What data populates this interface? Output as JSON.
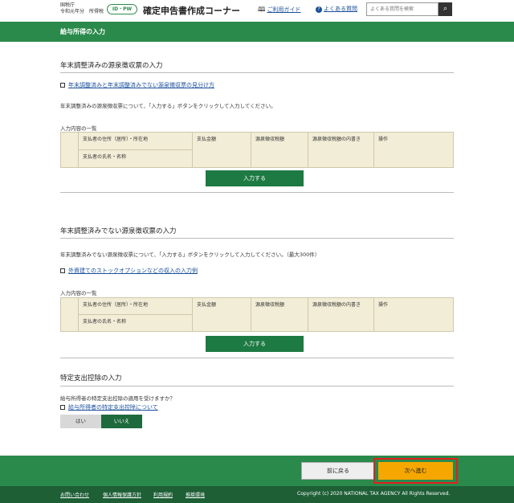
{
  "header": {
    "agency_line1": "国税庁",
    "agency_line2": "令和元年分　所得税",
    "id_badge": "ID・PW",
    "site_title": "確定申告書作成コーナー",
    "guide_link": "ご利用ガイド",
    "faq_link": "よくある質問",
    "search_placeholder": "よくある質問を検索",
    "icons": {
      "search": "search-icon",
      "guide": "book-icon",
      "faq": "question-icon"
    }
  },
  "page_title": "給与所得の入力",
  "section1": {
    "heading": "年末調整済みの源泉徴収票の入力",
    "link": "年末調整済みと年末調整済みでない源泉徴収票の見分け方",
    "desc": "年末調整済みの源泉徴収票について、「入力する」ボタンをクリックして入力してください。",
    "list_label": "入力内容の一覧",
    "table": {
      "col1_a": "支払者の住所（居所）・所在地",
      "col1_b": "支払者の氏名・名称",
      "col2": "支払金額",
      "col3": "源泉徴収税額",
      "col4": "源泉徴収税額の内書き",
      "col5": "操作"
    },
    "button": "入力する"
  },
  "section2": {
    "heading": "年末調整済みでない源泉徴収票の入力",
    "desc": "年末調整済みでない源泉徴収票について、「入力する」ボタンをクリックして入力してください。（最大300件）",
    "link": "外資建てのストックオプションなどの収入の入力例",
    "list_label": "入力内容の一覧",
    "table": {
      "col1_a": "支払者の住所（居所）・所在地",
      "col1_b": "支払者の氏名・名称",
      "col2": "支払金額",
      "col3": "源泉徴収税額",
      "col4": "源泉徴収税額の内書き",
      "col5": "操作"
    },
    "button": "入力する"
  },
  "section3": {
    "heading": "特定支出控除の入力",
    "question": "給与所得者の特定支出控除の適用を受けますか？",
    "link": "給与所得者の特定支出控除について",
    "yes": "はい",
    "no": "いいえ",
    "selected": "いいえ"
  },
  "footer": {
    "back_button": "前に戻る",
    "next_button": "次へ進む",
    "links": [
      "お問い合わせ",
      "個人情報保護方針",
      "利用規約",
      "推奨環境"
    ],
    "copyright": "Copyright (c) 2020 NATIONAL TAX AGENCY All Rights Reserved."
  },
  "colors": {
    "brand_green": "#2a8a4b",
    "button_green": "#1e7a43",
    "next_orange": "#f5a700",
    "highlight_red": "#e02020"
  }
}
